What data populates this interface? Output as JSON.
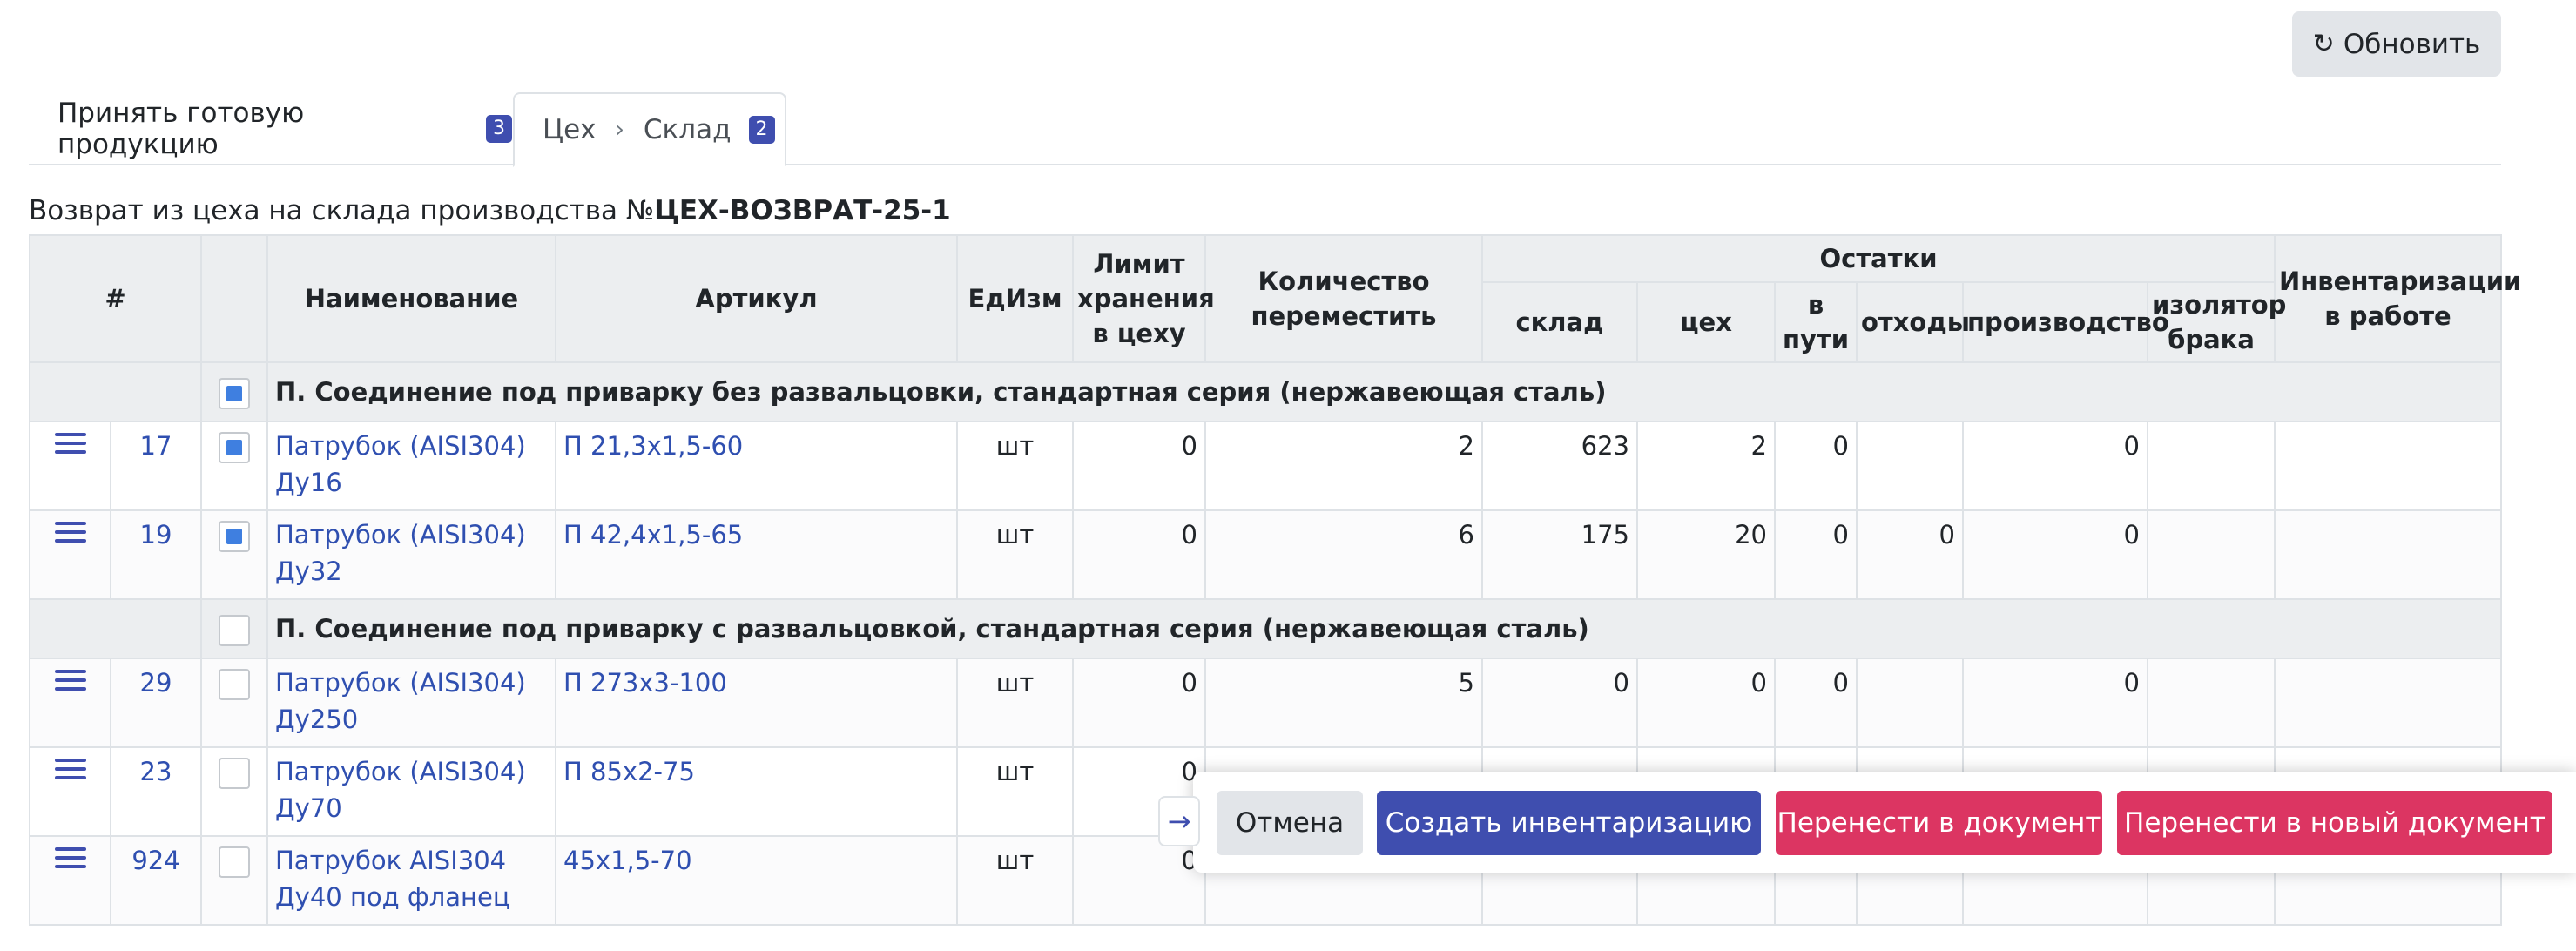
{
  "toolbar": {
    "refresh_label": "Обновить"
  },
  "tabs": [
    {
      "label": "Принять готовую продукцию",
      "badge": "3"
    },
    {
      "from": "Цех",
      "to": "Склад",
      "badge": "2"
    }
  ],
  "document": {
    "prefix": "Возврат из цеха на склада производства №",
    "number": "ЦЕХ-ВОЗВРАТ-25-1"
  },
  "table": {
    "headers": {
      "num": "#",
      "name": "Наименование",
      "article": "Артикул",
      "unit": "ЕдИзм",
      "limit": "Лимит хранения в цеху",
      "qty": "Количество переместить",
      "remains": "Остатки",
      "warehouse": "склад",
      "shop": "цех",
      "transit": "в пути",
      "waste": "отходы",
      "production": "производство",
      "defect": "изолятор брака",
      "inventory": "Инвентаризации в работе"
    },
    "groups": [
      {
        "title": "П. Соединение под приварку без развальцовки, стандартная серия (нержавеющая сталь)",
        "checked": true,
        "rows": [
          {
            "num": "17",
            "checked": true,
            "name": "Патрубок (AISI304) Ду16",
            "article": "П 21,3х1,5-60",
            "unit": "шт",
            "limit": "0",
            "qty": "2",
            "warehouse": "623",
            "shop": "2",
            "transit": "0",
            "waste": "",
            "production": "0",
            "defect": "",
            "inventory": ""
          },
          {
            "num": "19",
            "checked": true,
            "name": "Патрубок (AISI304) Ду32",
            "article": "П 42,4х1,5-65",
            "unit": "шт",
            "limit": "0",
            "qty": "6",
            "warehouse": "175",
            "shop": "20",
            "transit": "0",
            "waste": "0",
            "production": "0",
            "defect": "",
            "inventory": ""
          }
        ]
      },
      {
        "title": "П. Соединение под приварку с развальцовкой, стандартная серия (нержавеющая сталь)",
        "checked": false,
        "rows": [
          {
            "num": "29",
            "checked": false,
            "name": "Патрубок (AISI304) Ду250",
            "article": "П 273х3-100",
            "unit": "шт",
            "limit": "0",
            "qty": "5",
            "warehouse": "0",
            "shop": "0",
            "transit": "0",
            "waste": "",
            "production": "0",
            "defect": "",
            "inventory": ""
          },
          {
            "num": "23",
            "checked": false,
            "name": "Патрубок (AISI304) Ду70",
            "article": "П 85х2-75",
            "unit": "шт",
            "limit": "0",
            "qty": "",
            "warehouse": "",
            "shop": "",
            "transit": "",
            "waste": "",
            "production": "",
            "defect": "",
            "inventory": ""
          },
          {
            "num": "924",
            "checked": false,
            "name": "Патрубок AISI304 Ду40 под фланец",
            "article": "45х1,5-70",
            "unit": "шт",
            "limit": "0",
            "qty": "",
            "warehouse": "",
            "shop": "",
            "transit": "",
            "waste": "",
            "production": "",
            "defect": "",
            "inventory": ""
          }
        ]
      }
    ]
  },
  "actions": {
    "cancel": "Отмена",
    "create_inventory": "Создать инвентаризацию",
    "move_to_doc": "Перенести в документ",
    "move_to_new_doc": "Перенести в новый документ"
  },
  "icons": {
    "refresh": "refresh-icon",
    "menu": "hamburger-icon",
    "collapse": "arrow-right-icon",
    "breadcrumb": "chevron-right-icon"
  },
  "colors": {
    "primary": "#3f4eaf",
    "danger": "#dc3562",
    "link": "#2f4fb0",
    "header_bg": "#eceef0"
  }
}
